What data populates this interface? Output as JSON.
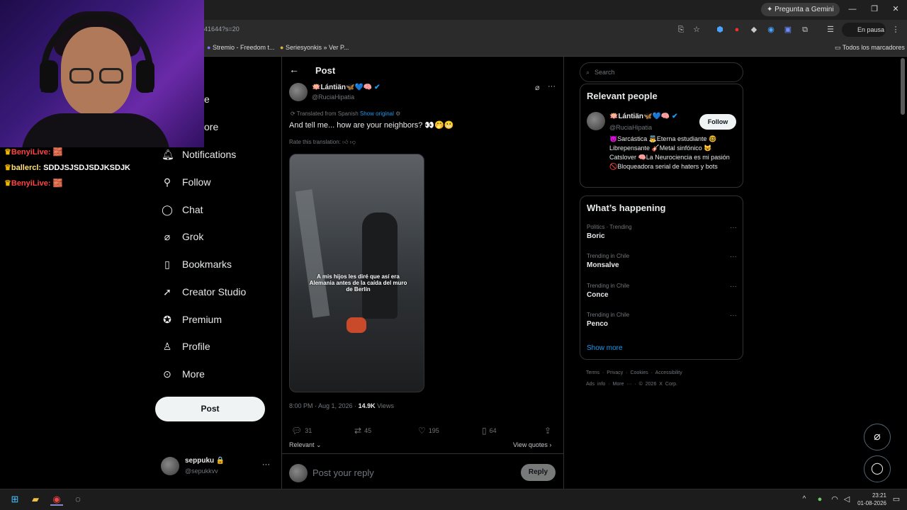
{
  "browser": {
    "gemini_button": "Pregunta a Gemini",
    "url_fragment": "41644?s=20",
    "profile_status": "En pausa",
    "bookmarks": [
      "Stremio - Freedom t...",
      "Seriesyonkis » Ver P..."
    ],
    "all_bookmarks": "Todos los marcadores"
  },
  "stream_chat": [
    {
      "user": "BenyiLive:",
      "text": "🧱"
    },
    {
      "user": "ballercl:",
      "text": "SDDJSJSDJSDJKSDJK"
    },
    {
      "user": "BenyiLive:",
      "text": "🧱"
    }
  ],
  "sidebar": {
    "partial_items": [
      "e",
      "ore"
    ],
    "items": [
      {
        "label": "Notifications",
        "icon": "bell-icon"
      },
      {
        "label": "Follow",
        "icon": "person-plus-icon"
      },
      {
        "label": "Chat",
        "icon": "chat-icon"
      },
      {
        "label": "Grok",
        "icon": "grok-icon"
      },
      {
        "label": "Bookmarks",
        "icon": "bookmark-icon"
      },
      {
        "label": "Creator Studio",
        "icon": "rocket-icon"
      },
      {
        "label": "Premium",
        "icon": "verified-icon"
      },
      {
        "label": "Profile",
        "icon": "person-icon"
      },
      {
        "label": "More",
        "icon": "more-circle-icon"
      }
    ],
    "post_button": "Post",
    "account": {
      "name": "seppuku 🔒",
      "handle": "@sepukkvv",
      "menu": "···"
    }
  },
  "post": {
    "header": "Post",
    "author_name": "🪷Lántiän🦋💙🧠",
    "author_handle": "@RuciaHipatia",
    "translated_label": "Translated from Spanish",
    "show_original": "Show original",
    "text": "And tell me... how are your neighbors? 👀🤭😬",
    "rate_translation": "Rate this translation:",
    "media_caption": "A mis hijos les diré que así era Alemania antes de la caída del muro de Berlín",
    "timestamp": "8:00 PM · Aug 1, 2026 · ",
    "views_count": "14.9K",
    "views_label": " Views",
    "stats": {
      "replies": "31",
      "reposts": "45",
      "likes": "195",
      "bookmarks": "64"
    },
    "sort": "Relevant",
    "view_quotes": "View quotes",
    "reply_placeholder": "Post your reply",
    "reply_button": "Reply"
  },
  "right": {
    "search_placeholder": "Search",
    "relevant_title": "Relevant people",
    "person": {
      "name": "🪷Lántiän🦋💙🧠",
      "handle": "@RuciaHipatia",
      "follow": "Follow",
      "bio": "😈Sarcástica 👼Eterna estudiante 🤓 Librepensante 🎸Metal sinfónico 😺 Catslover 🧠La Neurociencia es mi pasión 🚫Bloqueadora serial de haters y bots"
    },
    "happening_title": "What’s happening",
    "trends": [
      {
        "meta": "Politics · Trending",
        "name": "Boric"
      },
      {
        "meta": "Trending in Chile",
        "name": "Monsalve"
      },
      {
        "meta": "Trending in Chile",
        "name": "Conce"
      },
      {
        "meta": "Trending in Chile",
        "name": "Penco"
      }
    ],
    "show_more": "Show more",
    "footer_row1": [
      "Terms",
      "Privacy",
      "Cookies",
      "Accessibility"
    ],
    "footer_row2": [
      "Ads info",
      "More ···",
      "© 2026 X Corp."
    ]
  },
  "taskbar": {
    "time": "23:21",
    "date": "01-08-2026"
  },
  "colors": {
    "accent": "#1d9bf0",
    "bg": "#000000",
    "text": "#e7e9ea",
    "muted": "#71767b",
    "border": "#2f3336"
  }
}
